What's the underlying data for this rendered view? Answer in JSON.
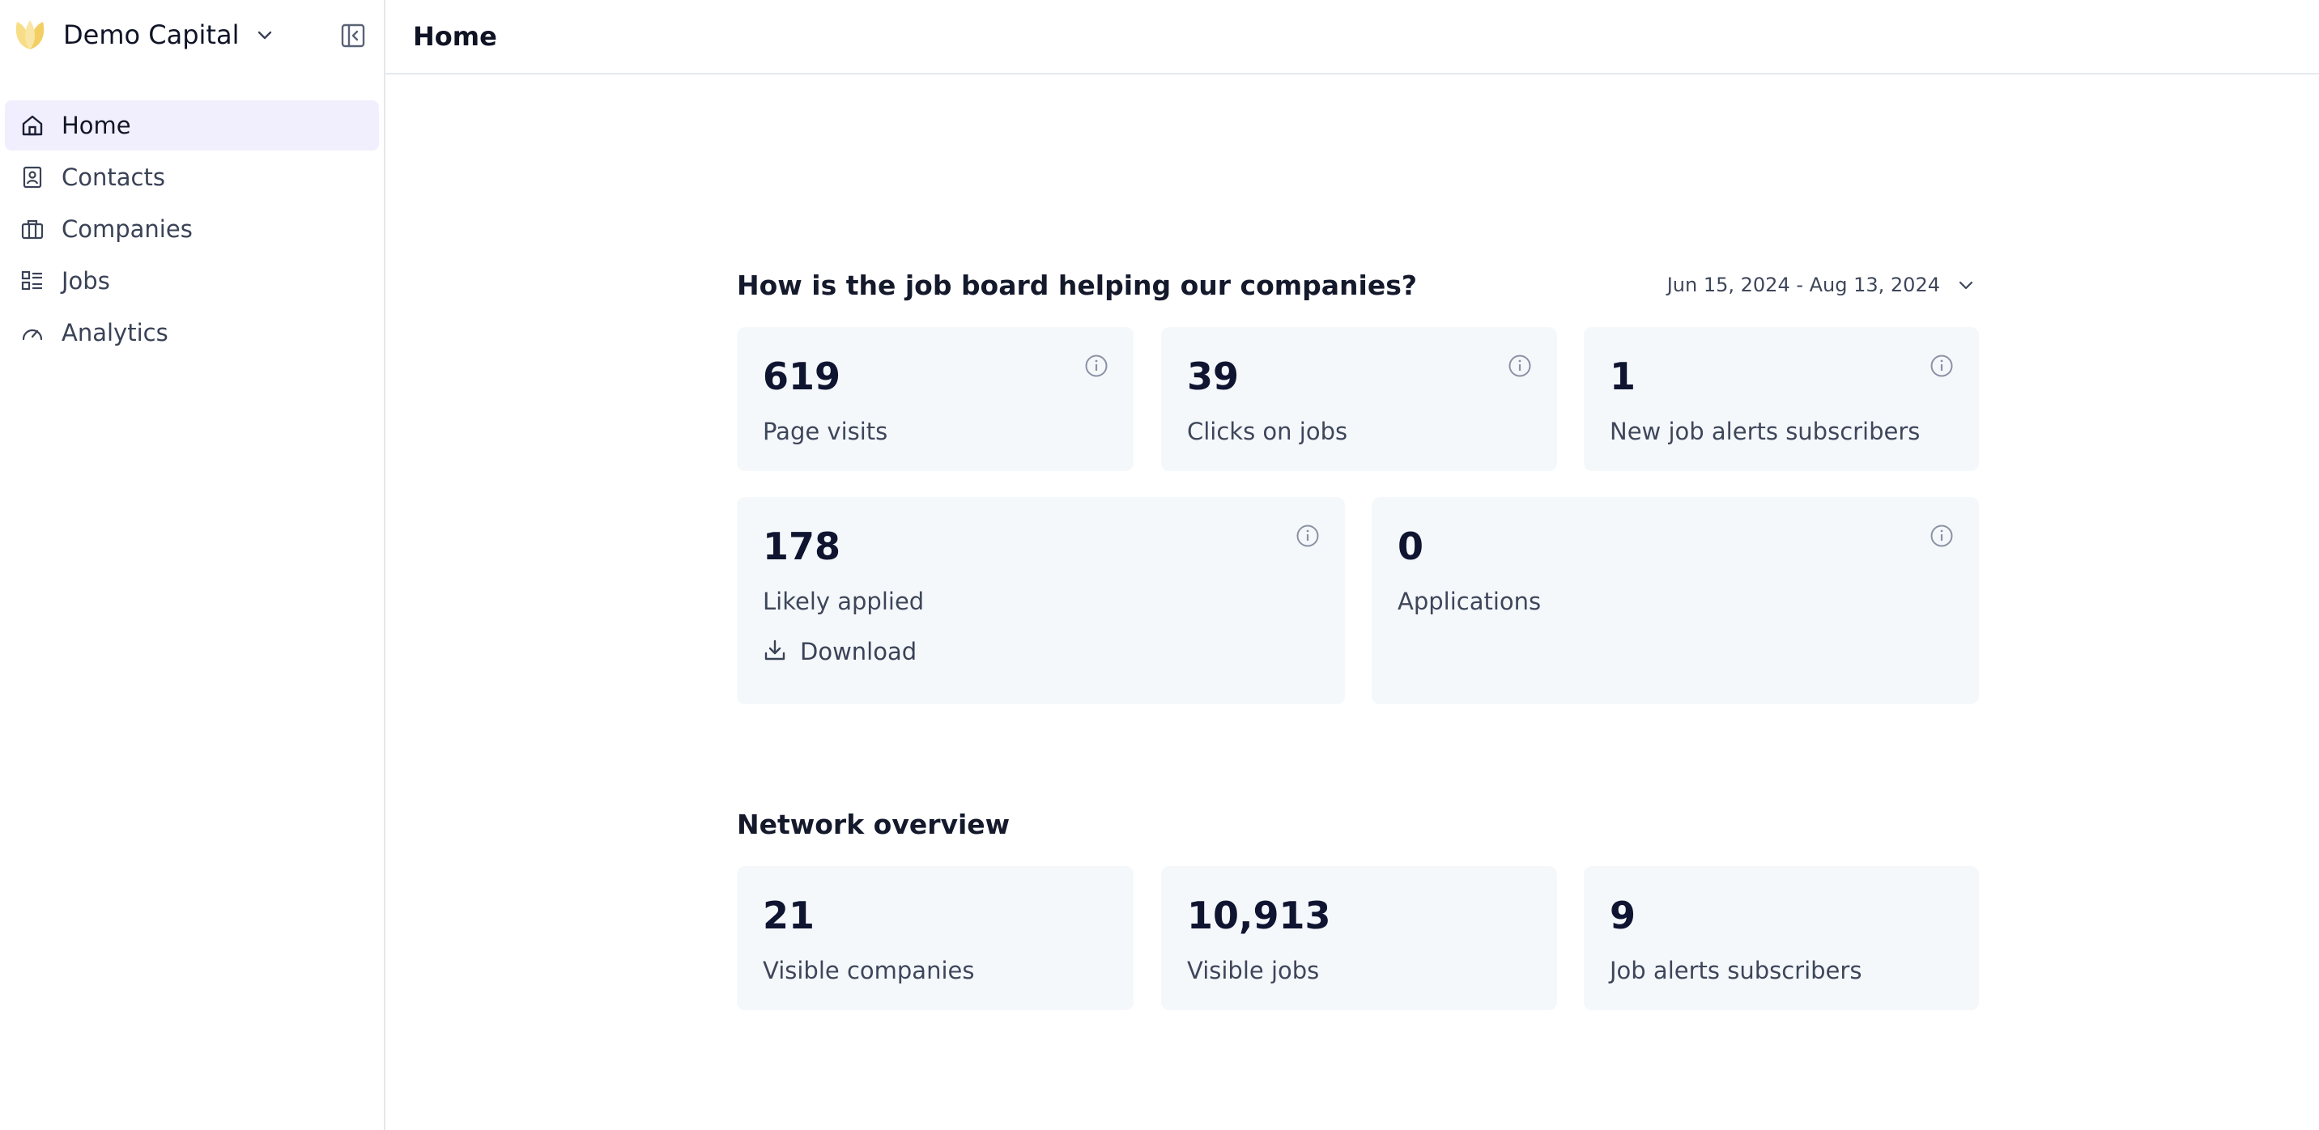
{
  "brand": {
    "name": "Demo Capital"
  },
  "sidebar": {
    "items": [
      {
        "label": "Home",
        "icon": "home-icon",
        "active": true
      },
      {
        "label": "Contacts",
        "icon": "contacts-icon"
      },
      {
        "label": "Companies",
        "icon": "briefcase-icon"
      },
      {
        "label": "Jobs",
        "icon": "list-icon"
      },
      {
        "label": "Analytics",
        "icon": "gauge-icon"
      }
    ]
  },
  "header": {
    "title": "Home"
  },
  "job_board": {
    "title": "How is the job board helping our companies?",
    "date_range": "Jun 15, 2024 - Aug 13, 2024",
    "cards": [
      {
        "value": "619",
        "label": "Page visits"
      },
      {
        "value": "39",
        "label": "Clicks on jobs"
      },
      {
        "value": "1",
        "label": "New job alerts subscribers"
      },
      {
        "value": "178",
        "label": "Likely applied",
        "action": "Download"
      },
      {
        "value": "0",
        "label": "Applications"
      }
    ]
  },
  "network": {
    "title": "Network overview",
    "cards": [
      {
        "value": "21",
        "label": "Visible companies"
      },
      {
        "value": "10,913",
        "label": "Visible jobs"
      },
      {
        "value": "9",
        "label": "Job alerts subscribers"
      }
    ]
  },
  "colors": {
    "accent_bg": "#f1effd",
    "card_bg": "#f5f8fb",
    "logo": "#f5d77a"
  }
}
